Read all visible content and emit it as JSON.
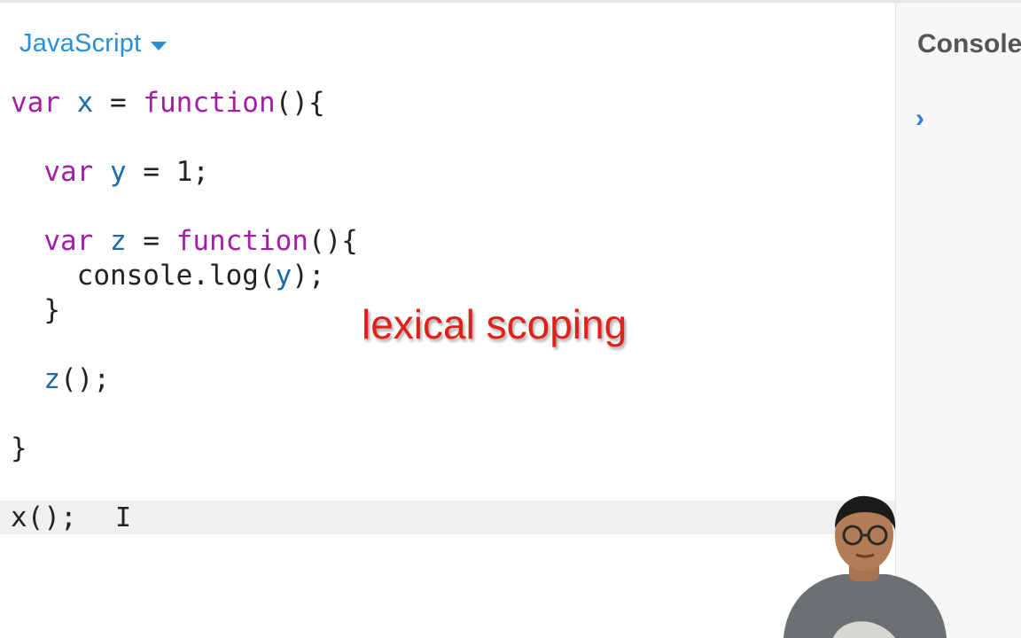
{
  "editor": {
    "language": "JavaScript",
    "code_lines": [
      {
        "segments": [
          {
            "t": "var ",
            "c": "kw"
          },
          {
            "t": "x",
            "c": "vb"
          },
          {
            "t": " = ",
            "c": ""
          },
          {
            "t": "function",
            "c": "kw"
          },
          {
            "t": "(){",
            "c": ""
          }
        ]
      },
      {
        "segments": []
      },
      {
        "segments": [
          {
            "t": "  "
          },
          {
            "t": "var ",
            "c": "kw"
          },
          {
            "t": "y",
            "c": "vb"
          },
          {
            "t": " = 1;",
            "c": ""
          }
        ]
      },
      {
        "segments": []
      },
      {
        "segments": [
          {
            "t": "  "
          },
          {
            "t": "var ",
            "c": "kw"
          },
          {
            "t": "z",
            "c": "vb"
          },
          {
            "t": " = ",
            "c": ""
          },
          {
            "t": "function",
            "c": "kw"
          },
          {
            "t": "(){",
            "c": ""
          }
        ]
      },
      {
        "segments": [
          {
            "t": "    console.log(",
            "c": ""
          },
          {
            "t": "y",
            "c": "vb"
          },
          {
            "t": ");",
            "c": ""
          }
        ]
      },
      {
        "segments": [
          {
            "t": "  }",
            "c": ""
          }
        ]
      },
      {
        "segments": []
      },
      {
        "segments": [
          {
            "t": "  "
          },
          {
            "t": "z",
            "c": "vb"
          },
          {
            "t": "();",
            "c": ""
          }
        ]
      },
      {
        "segments": []
      },
      {
        "segments": [
          {
            "t": "}",
            "c": ""
          }
        ]
      },
      {
        "segments": []
      },
      {
        "segments": [
          {
            "t": "x();",
            "c": ""
          }
        ]
      }
    ],
    "active_line_index": 12
  },
  "overlay": {
    "caption": "lexical scoping"
  },
  "console": {
    "title": "Console",
    "prompt": "›"
  },
  "colors": {
    "keyword": "#a31ea6",
    "variable": "#1e6aa8",
    "accent": "#2a8fd6",
    "caption": "#e0201a"
  }
}
